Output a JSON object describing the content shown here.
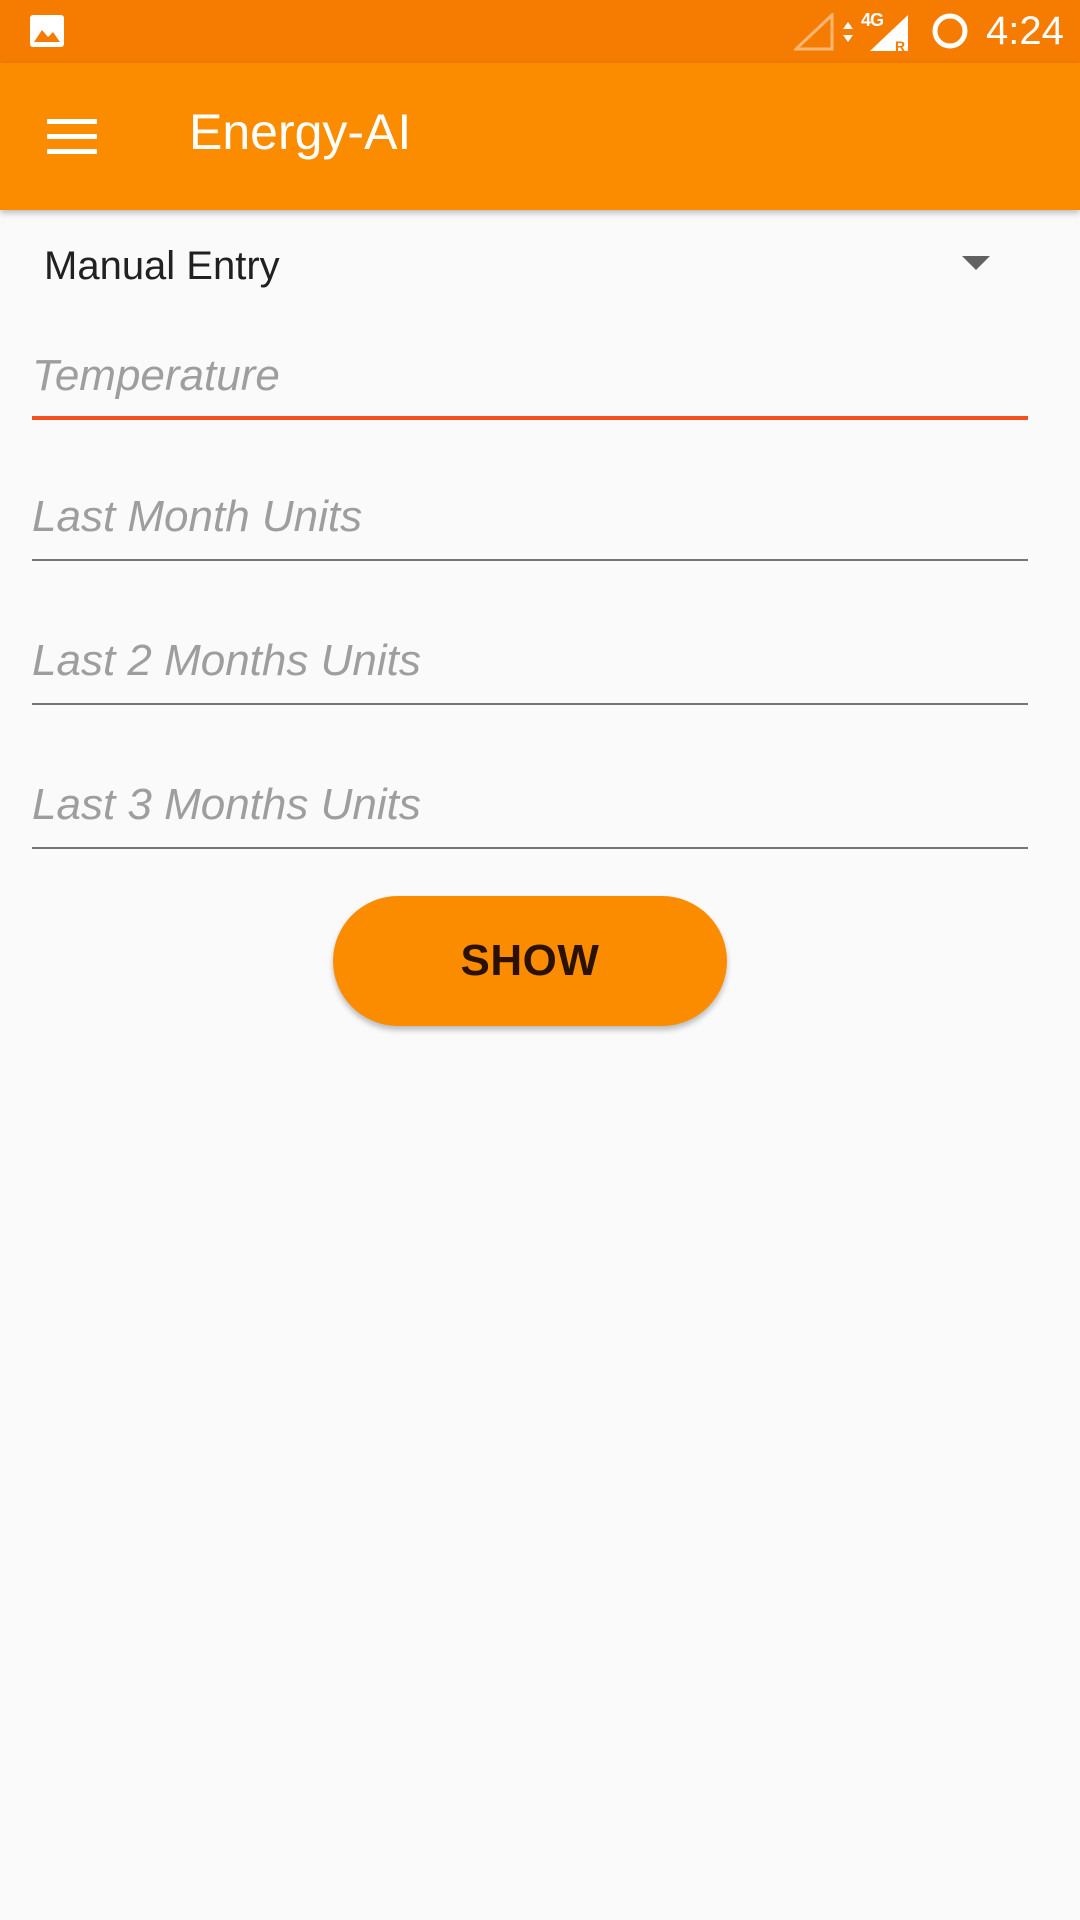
{
  "status_bar": {
    "network_type": "4G",
    "roaming_indicator": "R",
    "time": "4:24",
    "icons": [
      "gallery-icon",
      "signal-empty-icon",
      "data-arrows-icon",
      "signal-icon",
      "battery-icon"
    ],
    "background_color": "#f57c00"
  },
  "app_bar": {
    "title": "Energy-AI",
    "menu_icon": "hamburger-menu-icon",
    "background_color": "#fb8c00"
  },
  "form": {
    "mode_selector": {
      "selected_value": "Manual Entry"
    },
    "fields": [
      {
        "name": "temperature",
        "value": "",
        "placeholder": "Temperature",
        "focused": true
      },
      {
        "name": "last-month-units",
        "value": "",
        "placeholder": "Last Month Units",
        "focused": false
      },
      {
        "name": "last-2-months-units",
        "value": "",
        "placeholder": "Last 2 Months Units",
        "focused": false
      },
      {
        "name": "last-3-months-units",
        "value": "",
        "placeholder": "Last 3 Months Units",
        "focused": false
      }
    ],
    "submit_label": "SHOW",
    "accent_color": "#f4511e"
  }
}
